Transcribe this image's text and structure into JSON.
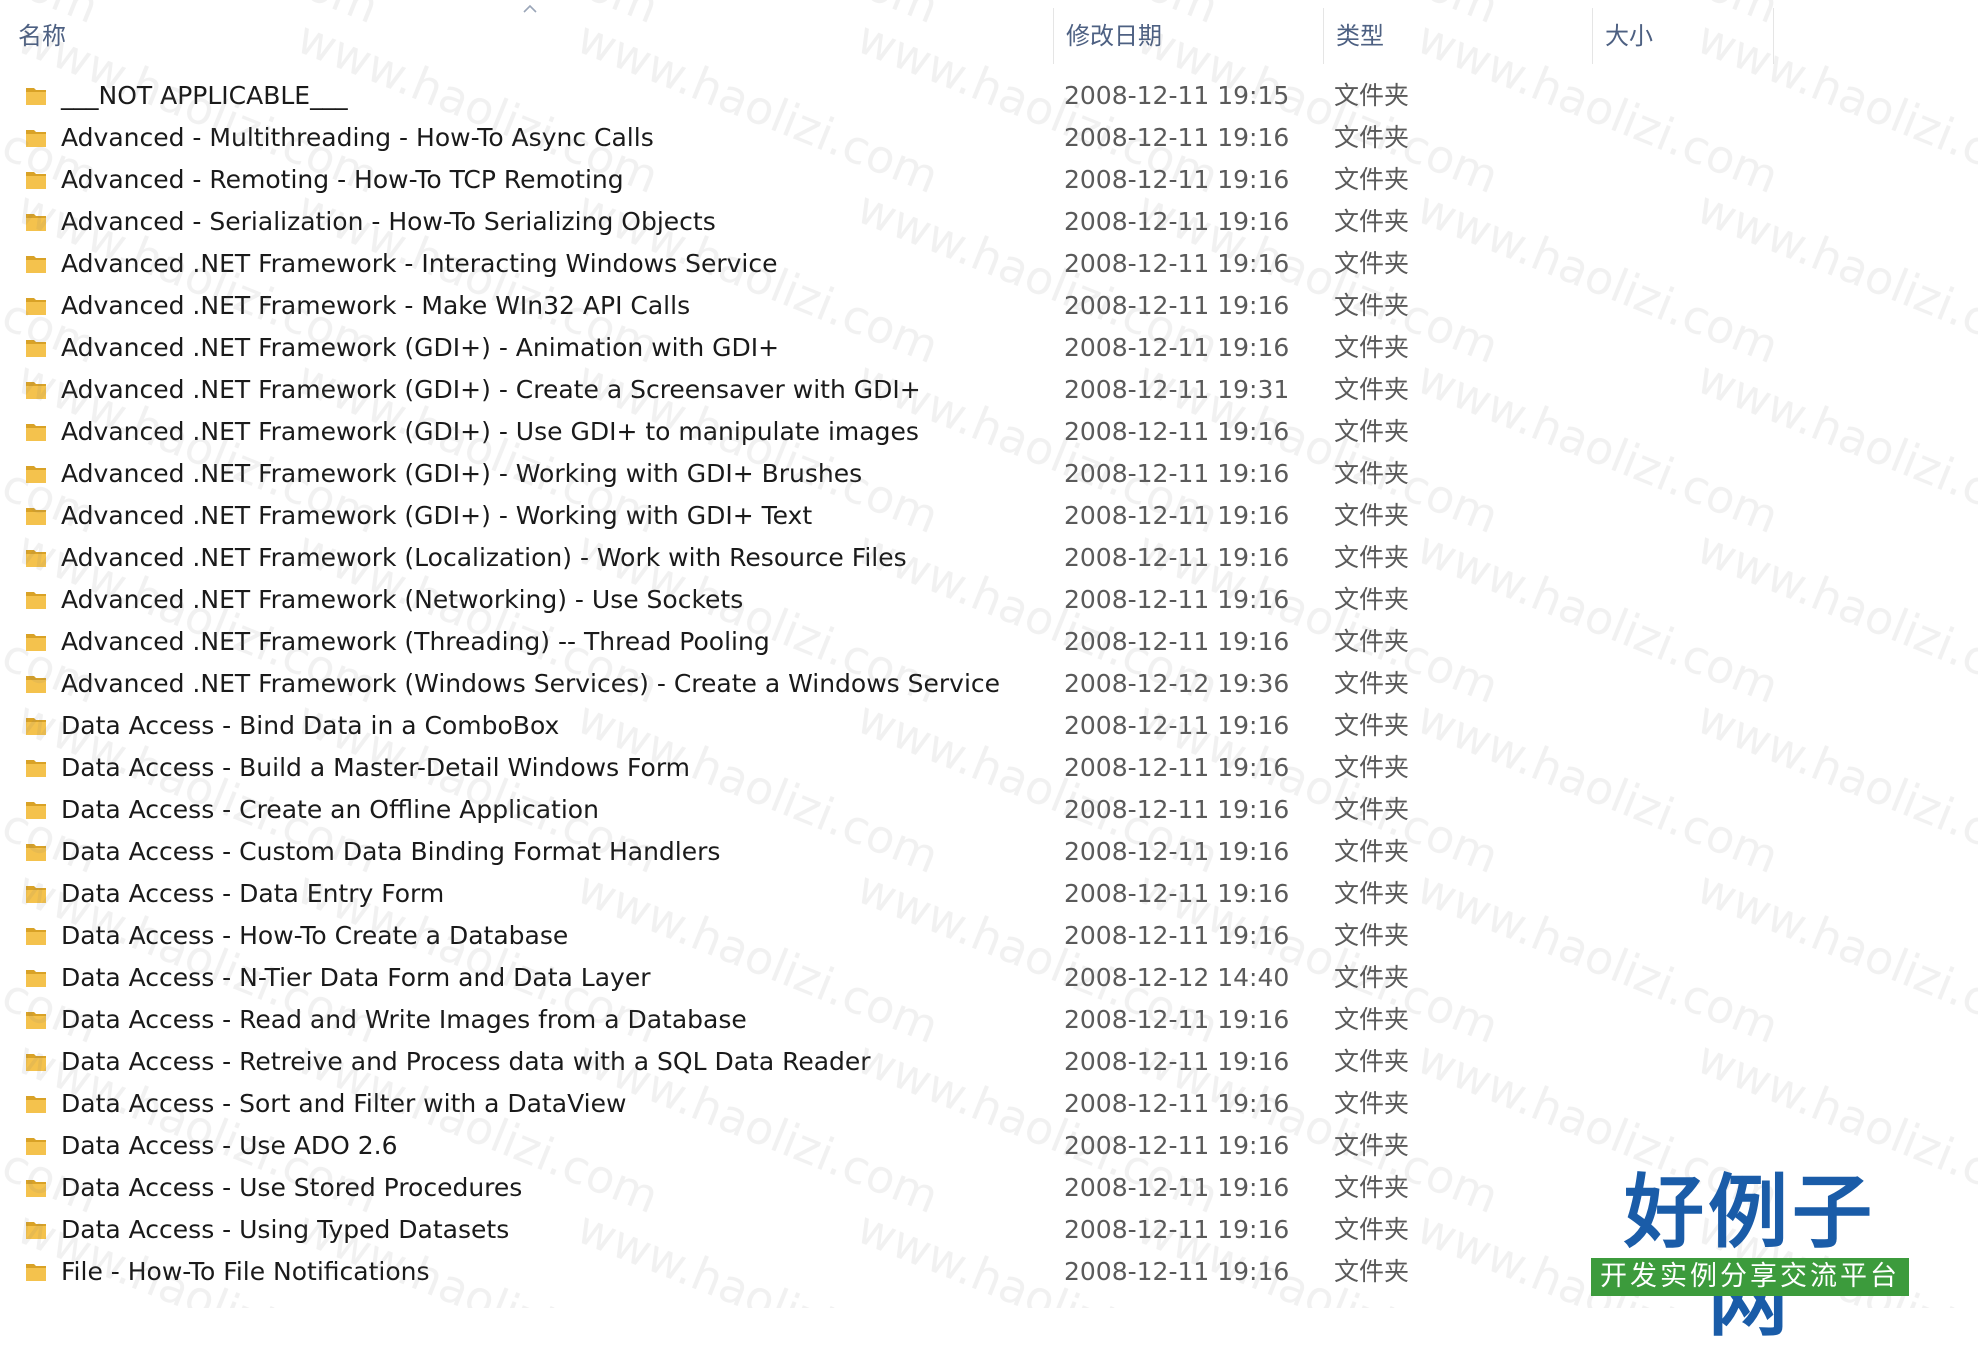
{
  "columns": {
    "name": "名称",
    "date_modified": "修改日期",
    "type": "类型",
    "size": "大小"
  },
  "sort": {
    "column": "name",
    "icon": "sort-up-arrow-icon"
  },
  "files": [
    {
      "icon": "folder-icon",
      "name": "___NOT APPLICABLE___",
      "date": "2008-12-11 19:15",
      "type": "文件夹",
      "size": ""
    },
    {
      "icon": "folder-icon",
      "name": "Advanced - Multithreading - How-To Async Calls",
      "date": "2008-12-11 19:16",
      "type": "文件夹",
      "size": ""
    },
    {
      "icon": "folder-icon",
      "name": "Advanced - Remoting - How-To TCP Remoting",
      "date": "2008-12-11 19:16",
      "type": "文件夹",
      "size": ""
    },
    {
      "icon": "folder-icon",
      "name": "Advanced - Serialization - How-To Serializing Objects",
      "date": "2008-12-11 19:16",
      "type": "文件夹",
      "size": ""
    },
    {
      "icon": "folder-icon",
      "name": "Advanced .NET Framework - Interacting Windows Service",
      "date": "2008-12-11 19:16",
      "type": "文件夹",
      "size": ""
    },
    {
      "icon": "folder-icon",
      "name": "Advanced .NET Framework - Make WIn32 API Calls",
      "date": "2008-12-11 19:16",
      "type": "文件夹",
      "size": ""
    },
    {
      "icon": "folder-icon",
      "name": "Advanced .NET Framework (GDI+) - Animation with GDI+",
      "date": "2008-12-11 19:16",
      "type": "文件夹",
      "size": ""
    },
    {
      "icon": "folder-icon",
      "name": "Advanced .NET Framework (GDI+) - Create a Screensaver with GDI+",
      "date": "2008-12-11 19:31",
      "type": "文件夹",
      "size": ""
    },
    {
      "icon": "folder-icon",
      "name": "Advanced .NET Framework (GDI+) - Use GDI+ to manipulate images",
      "date": "2008-12-11 19:16",
      "type": "文件夹",
      "size": ""
    },
    {
      "icon": "folder-icon",
      "name": "Advanced .NET Framework (GDI+) - Working with GDI+ Brushes",
      "date": "2008-12-11 19:16",
      "type": "文件夹",
      "size": ""
    },
    {
      "icon": "folder-icon",
      "name": "Advanced .NET Framework (GDI+) - Working with GDI+ Text",
      "date": "2008-12-11 19:16",
      "type": "文件夹",
      "size": ""
    },
    {
      "icon": "folder-icon",
      "name": "Advanced .NET Framework (Localization) - Work with Resource Files",
      "date": "2008-12-11 19:16",
      "type": "文件夹",
      "size": ""
    },
    {
      "icon": "folder-icon",
      "name": "Advanced .NET Framework (Networking) - Use Sockets",
      "date": "2008-12-11 19:16",
      "type": "文件夹",
      "size": ""
    },
    {
      "icon": "folder-icon",
      "name": "Advanced .NET Framework (Threading) -- Thread Pooling",
      "date": "2008-12-11 19:16",
      "type": "文件夹",
      "size": ""
    },
    {
      "icon": "folder-icon",
      "name": "Advanced .NET Framework (Windows Services) - Create a Windows Service",
      "date": "2008-12-12 19:36",
      "type": "文件夹",
      "size": ""
    },
    {
      "icon": "folder-icon",
      "name": "Data Access - Bind Data in a ComboBox",
      "date": "2008-12-11 19:16",
      "type": "文件夹",
      "size": ""
    },
    {
      "icon": "folder-icon",
      "name": "Data Access - Build a Master-Detail Windows Form",
      "date": "2008-12-11 19:16",
      "type": "文件夹",
      "size": ""
    },
    {
      "icon": "folder-icon",
      "name": "Data Access - Create an Offline Application",
      "date": "2008-12-11 19:16",
      "type": "文件夹",
      "size": ""
    },
    {
      "icon": "folder-icon",
      "name": "Data Access - Custom Data Binding Format Handlers",
      "date": "2008-12-11 19:16",
      "type": "文件夹",
      "size": ""
    },
    {
      "icon": "folder-icon",
      "name": "Data Access - Data Entry Form",
      "date": "2008-12-11 19:16",
      "type": "文件夹",
      "size": ""
    },
    {
      "icon": "folder-icon",
      "name": "Data Access - How-To Create a Database",
      "date": "2008-12-11 19:16",
      "type": "文件夹",
      "size": ""
    },
    {
      "icon": "folder-icon",
      "name": "Data Access - N-Tier Data Form and Data Layer",
      "date": "2008-12-12 14:40",
      "type": "文件夹",
      "size": ""
    },
    {
      "icon": "folder-icon",
      "name": "Data Access - Read and Write Images from a Database",
      "date": "2008-12-11 19:16",
      "type": "文件夹",
      "size": ""
    },
    {
      "icon": "folder-icon",
      "name": "Data Access - Retreive and Process data with a SQL Data Reader",
      "date": "2008-12-11 19:16",
      "type": "文件夹",
      "size": ""
    },
    {
      "icon": "folder-icon",
      "name": "Data Access - Sort and Filter with a DataView",
      "date": "2008-12-11 19:16",
      "type": "文件夹",
      "size": ""
    },
    {
      "icon": "folder-icon",
      "name": "Data Access - Use ADO 2.6",
      "date": "2008-12-11 19:16",
      "type": "文件夹",
      "size": ""
    },
    {
      "icon": "folder-icon",
      "name": "Data Access - Use Stored Procedures",
      "date": "2008-12-11 19:16",
      "type": "文件夹",
      "size": ""
    },
    {
      "icon": "folder-icon",
      "name": "Data Access - Using Typed Datasets",
      "date": "2008-12-11 19:16",
      "type": "文件夹",
      "size": ""
    },
    {
      "icon": "folder-icon",
      "name": "File - How-To File Notifications",
      "date": "2008-12-11 19:16",
      "type": "文件夹",
      "size": ""
    }
  ],
  "watermark": {
    "text": "www.haolizi.com"
  },
  "logo": {
    "title": "好例子网",
    "subtitle": "开发实例分享交流平台",
    "title_color": "#1a5ca8",
    "subtitle_bg": "#3c9b3c"
  },
  "colors": {
    "header_text": "#4d6082",
    "folder_yellow": "#f4c24d",
    "folder_dark": "#d9a227",
    "row_text": "#1a1a1a",
    "meta_text": "#5a5a5a"
  }
}
